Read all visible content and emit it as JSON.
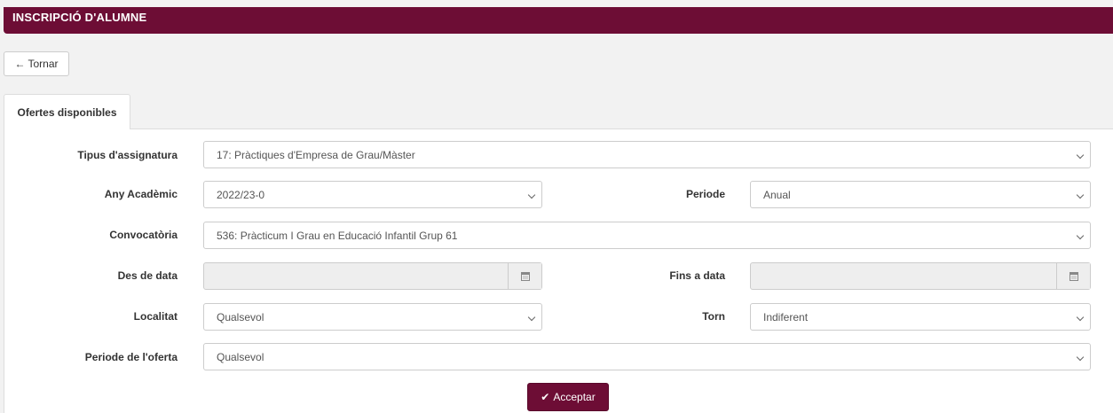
{
  "header": {
    "title": "INSCRIPCIÓ D'ALUMNE"
  },
  "back_button": {
    "label": "Tornar",
    "icon": "arrow-left-icon"
  },
  "tabs": [
    {
      "label": "Ofertes disponibles",
      "active": true
    }
  ],
  "form": {
    "tipus": {
      "label": "Tipus d'assignatura",
      "value": "17: Pràctiques d'Empresa de Grau/Màster"
    },
    "any": {
      "label": "Any Acadèmic",
      "value": "2022/23-0"
    },
    "periode": {
      "label": "Periode",
      "value": "Anual"
    },
    "convocatoria": {
      "label": "Convocatòria",
      "value": "536: Pràcticum I Grau en Educació Infantil Grup 61"
    },
    "des_de_data": {
      "label": "Des de data",
      "value": ""
    },
    "fins_a_data": {
      "label": "Fins a data",
      "value": ""
    },
    "localitat": {
      "label": "Localitat",
      "value": "Qualsevol"
    },
    "torn": {
      "label": "Torn",
      "value": "Indiferent"
    },
    "periode_oferta": {
      "label": "Periode de l'oferta",
      "value": "Qualsevol"
    }
  },
  "accept_button": {
    "label": "Acceptar",
    "icon": "check-icon"
  },
  "colors": {
    "brand": "#6d0d35"
  }
}
